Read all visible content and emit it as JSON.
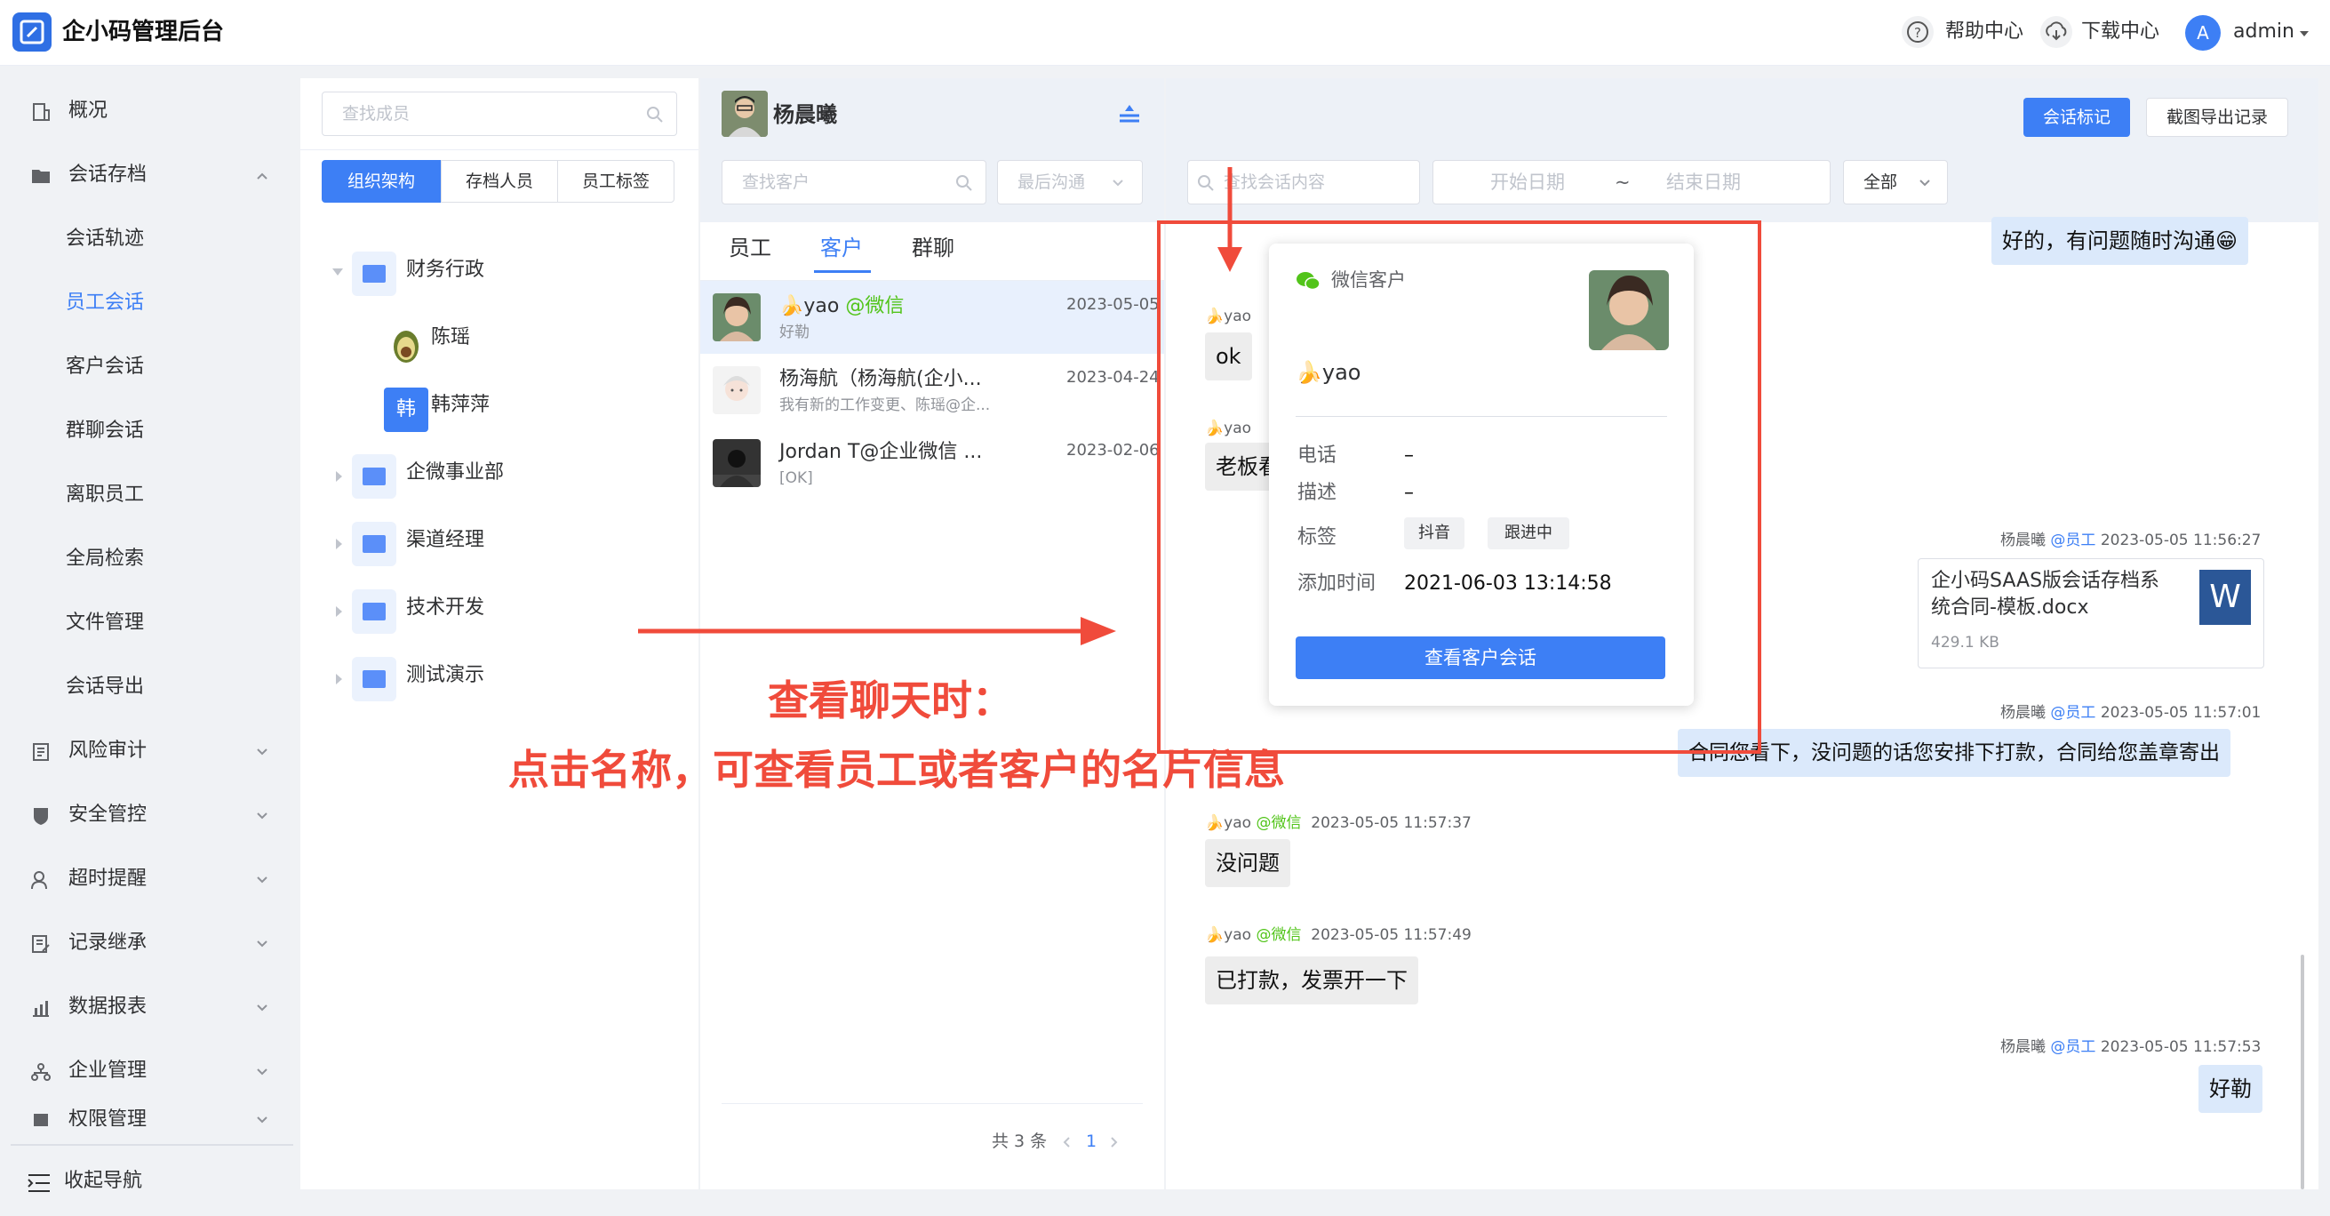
{
  "app": {
    "title": "企小码管理后台"
  },
  "header": {
    "help": "帮助中心",
    "download": "下载中心",
    "avatar_letter": "A",
    "user": "admin"
  },
  "nav": {
    "items": [
      {
        "label": "概况"
      },
      {
        "label": "会话存档"
      },
      {
        "label": "会话轨迹"
      },
      {
        "label": "员工会话"
      },
      {
        "label": "客户会话"
      },
      {
        "label": "群聊会话"
      },
      {
        "label": "离职员工"
      },
      {
        "label": "全局检索"
      },
      {
        "label": "文件管理"
      },
      {
        "label": "会话导出"
      },
      {
        "label": "风险审计"
      },
      {
        "label": "安全管控"
      },
      {
        "label": "超时提醒"
      },
      {
        "label": "记录继承"
      },
      {
        "label": "数据报表"
      },
      {
        "label": "企业管理"
      },
      {
        "label": "权限管理"
      }
    ],
    "collapse": "收起导航"
  },
  "members": {
    "search_placeholder": "查找成员",
    "tabs": [
      "组织架构",
      "存档人员",
      "员工标签"
    ],
    "tree": [
      {
        "label": "财务行政"
      },
      {
        "label": "陈瑶"
      },
      {
        "label": "韩萍萍",
        "avatar_text": "韩"
      },
      {
        "label": "企微事业部"
      },
      {
        "label": "渠道经理"
      },
      {
        "label": "技术开发"
      },
      {
        "label": "测试演示"
      }
    ]
  },
  "conversations": {
    "employee_name": "杨晨曦",
    "search_placeholder": "查找客户",
    "sort_placeholder": "最后沟通",
    "tabs": [
      "员工",
      "客户",
      "群聊"
    ],
    "items": [
      {
        "name": "yao",
        "source": "@微信",
        "preview": "好勒",
        "date": "2023-05-05"
      },
      {
        "name": "杨海航（杨海航(企小...",
        "preview": "我有新的工作变更、陈瑶@企...",
        "date": "2023-04-24"
      },
      {
        "name": "Jordan T@企业微信 ...",
        "preview": "[OK]",
        "date": "2023-02-06"
      }
    ],
    "total": "共 3 条",
    "page": "1"
  },
  "chat": {
    "tag_button": "会话标记",
    "export_button": "截图导出记录",
    "search_placeholder": "查找会话内容",
    "start_date": "开始日期",
    "tilde": "~",
    "end_date": "结束日期",
    "filter": "全部",
    "messages": [
      {
        "text": "好的，有问题随时沟通😁"
      },
      {
        "sender": "yao",
        "text": "ok"
      },
      {
        "sender": "yao",
        "text": "老板看"
      },
      {
        "sender": "杨晨曦",
        "source": "@员工",
        "time": "2023-05-05 11:56:27"
      },
      {
        "sender": "杨晨曦",
        "source": "@员工",
        "time": "2023-05-05 11:57:01",
        "text": "合同您看下，没问题的话您安排下打款，合同给您盖章寄出"
      },
      {
        "sender": "yao",
        "source": "@微信",
        "time": "2023-05-05 11:57:37",
        "text": "没问题"
      },
      {
        "sender": "yao",
        "source": "@微信",
        "time": "2023-05-05 11:57:49",
        "text": "已打款，发票开一下"
      },
      {
        "sender": "杨晨曦",
        "source": "@员工",
        "time": "2023-05-05 11:57:53",
        "text": "好勒"
      }
    ],
    "file": {
      "name_line1": "企小码SAAS版会话存档系",
      "name_line2": "统合同-模板.docx",
      "size": "429.1 KB",
      "icon_letter": "W"
    }
  },
  "card": {
    "type": "微信客户",
    "name": "yao",
    "phone_label": "电话",
    "phone": "–",
    "desc_label": "描述",
    "desc": "–",
    "tags_label": "标签",
    "tags": [
      "抖音",
      "跟进中"
    ],
    "added_label": "添加时间",
    "added": "2021-06-03 13:14:58",
    "button": "查看客户会话"
  },
  "annotation": {
    "line1": "查看聊天时：",
    "line2": "点击名称，可查看员工或者客户的名片信息"
  },
  "colors": {
    "accent": "#3d7ff5",
    "annotation": "#f04b3b",
    "wechat": "#52c41a"
  }
}
